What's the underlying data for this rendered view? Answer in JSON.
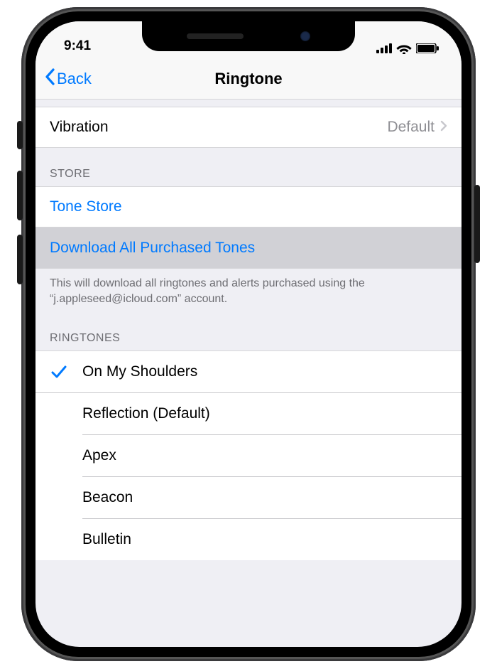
{
  "status": {
    "time": "9:41"
  },
  "nav": {
    "back": "Back",
    "title": "Ringtone"
  },
  "vibration": {
    "label": "Vibration",
    "value": "Default"
  },
  "store": {
    "header": "STORE",
    "toneStore": "Tone Store",
    "downloadAll": "Download All Purchased Tones",
    "footer": "This will download all ringtones and alerts purchased using the “j.appleseed@icloud.com” account."
  },
  "ringtones": {
    "header": "RINGTONES",
    "selected": "On My Shoulders",
    "items": [
      "On My Shoulders",
      "Reflection (Default)",
      "Apex",
      "Beacon",
      "Bulletin"
    ]
  }
}
